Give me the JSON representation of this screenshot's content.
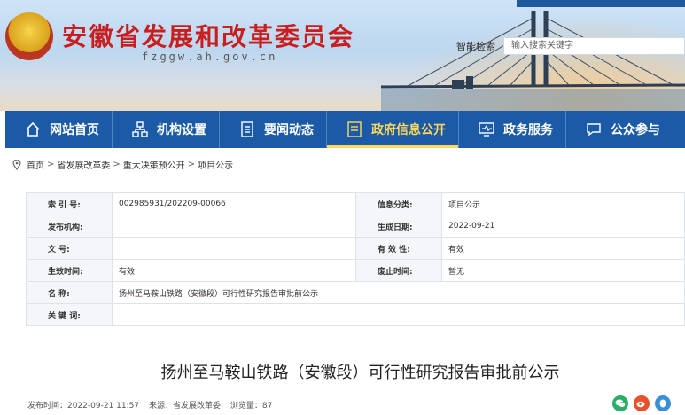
{
  "header": {
    "title": "安徽省发展和改革委员会",
    "domain": "fzggw.ah.gov.cn",
    "search_label": "智能检索",
    "search_placeholder": "输入搜索关键字"
  },
  "nav": {
    "items": [
      {
        "label": "网站首页",
        "icon": "home-icon"
      },
      {
        "label": "机构设置",
        "icon": "org-chart-icon"
      },
      {
        "label": "要闻动态",
        "icon": "news-icon"
      },
      {
        "label": "政府信息公开",
        "icon": "info-open-icon",
        "active": true
      },
      {
        "label": "政务服务",
        "icon": "monitor-icon"
      },
      {
        "label": "公众参与",
        "icon": "chat-icon"
      }
    ],
    "active_color": "#ffd75a",
    "bar_color": "#1a5aa6"
  },
  "breadcrumb": {
    "items": [
      "首页",
      "省发展改革委",
      "重大决策预公开",
      "项目公示"
    ],
    "separator": ">"
  },
  "info_table": {
    "index_label": "索 引 号:",
    "index_value": "002985931/202209-00066",
    "category_label": "信息分类:",
    "category_value": "项目公示",
    "publisher_label": "发布机构:",
    "publisher_value": "",
    "date_label": "生成日期:",
    "date_value": "2022-09-21",
    "doc_label": "文      号:",
    "doc_value": "",
    "validity_label": "有 效 性:",
    "validity_value": "有效",
    "effective_label": "生效时间:",
    "effective_value": "有效",
    "repeal_label": "废止时间:",
    "repeal_value": "暂无",
    "name_label": "名      称:",
    "name_value": "扬州至马鞍山铁路（安徽段）可行性研究报告审批前公示",
    "keywords_label": "关 键 词:",
    "keywords_value": ""
  },
  "article": {
    "title": "扬州至马鞍山铁路（安徽段）可行性研究报告审批前公示",
    "publish_time": "发布时间：2022-09-21 11:57",
    "source": "来源：省发展改革委",
    "views": "浏览量：87"
  }
}
